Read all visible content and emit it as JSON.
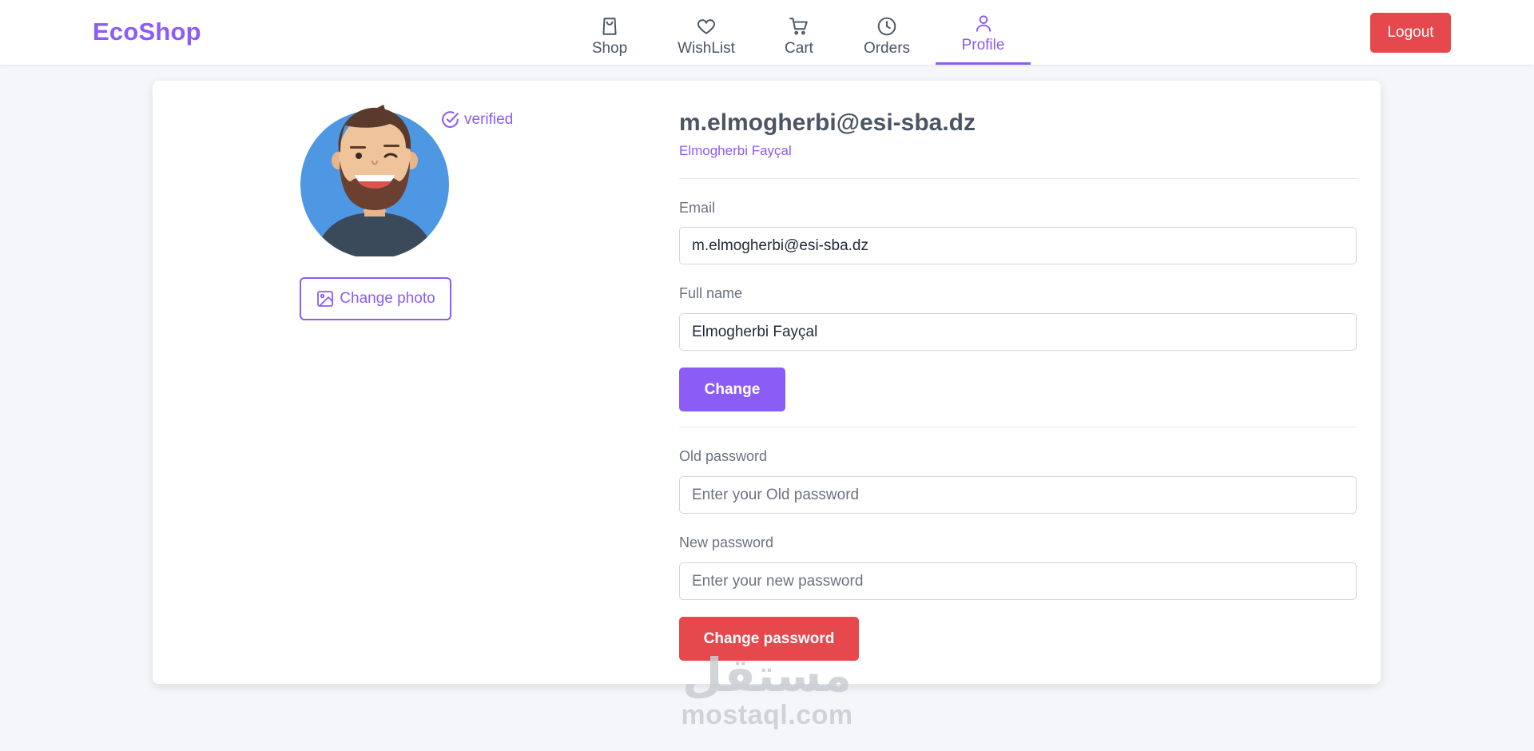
{
  "header": {
    "brand": "EcoShop",
    "nav": [
      {
        "label": "Shop",
        "icon": "shopping-bag-icon"
      },
      {
        "label": "WishList",
        "icon": "heart-icon"
      },
      {
        "label": "Cart",
        "icon": "cart-icon"
      },
      {
        "label": "Orders",
        "icon": "clock-icon"
      },
      {
        "label": "Profile",
        "icon": "user-icon",
        "active": true
      }
    ],
    "logout_label": "Logout"
  },
  "profile": {
    "verified_label": "verified",
    "change_photo_label": "Change photo",
    "email_heading": "m.elmogherbi@esi-sba.dz",
    "name_subheading": "Elmogherbi Fayçal"
  },
  "form": {
    "email_label": "Email",
    "email_value": "m.elmogherbi@esi-sba.dz",
    "fullname_label": "Full name",
    "fullname_value": "Elmogherbi Fayçal",
    "change_label": "Change",
    "old_password_label": "Old password",
    "old_password_placeholder": "Enter your Old password",
    "new_password_label": "New password",
    "new_password_placeholder": "Enter your new password",
    "change_password_label": "Change password"
  },
  "watermark": {
    "arabic": "مستقل",
    "latin": "mostaql.com"
  },
  "colors": {
    "accent": "#8b5cf6",
    "danger": "#e5484d",
    "background": "#f4f6fa"
  }
}
